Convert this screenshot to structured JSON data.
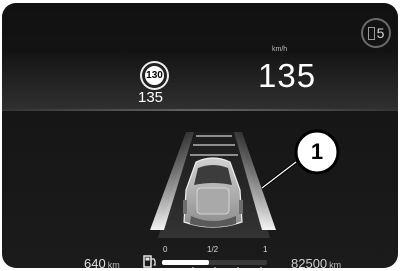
{
  "gear": {
    "label": "5"
  },
  "speed_limit": {
    "sign": "130",
    "value": "135"
  },
  "speed": {
    "unit": "km/h",
    "value": "135"
  },
  "callout": {
    "label": "1"
  },
  "range": {
    "value": "640",
    "unit": "km"
  },
  "fuel": {
    "min_label": "0",
    "mid_label": "1/2",
    "max_label": "1",
    "level": 0.45
  },
  "odometer": {
    "value": "82500",
    "unit": "km"
  }
}
